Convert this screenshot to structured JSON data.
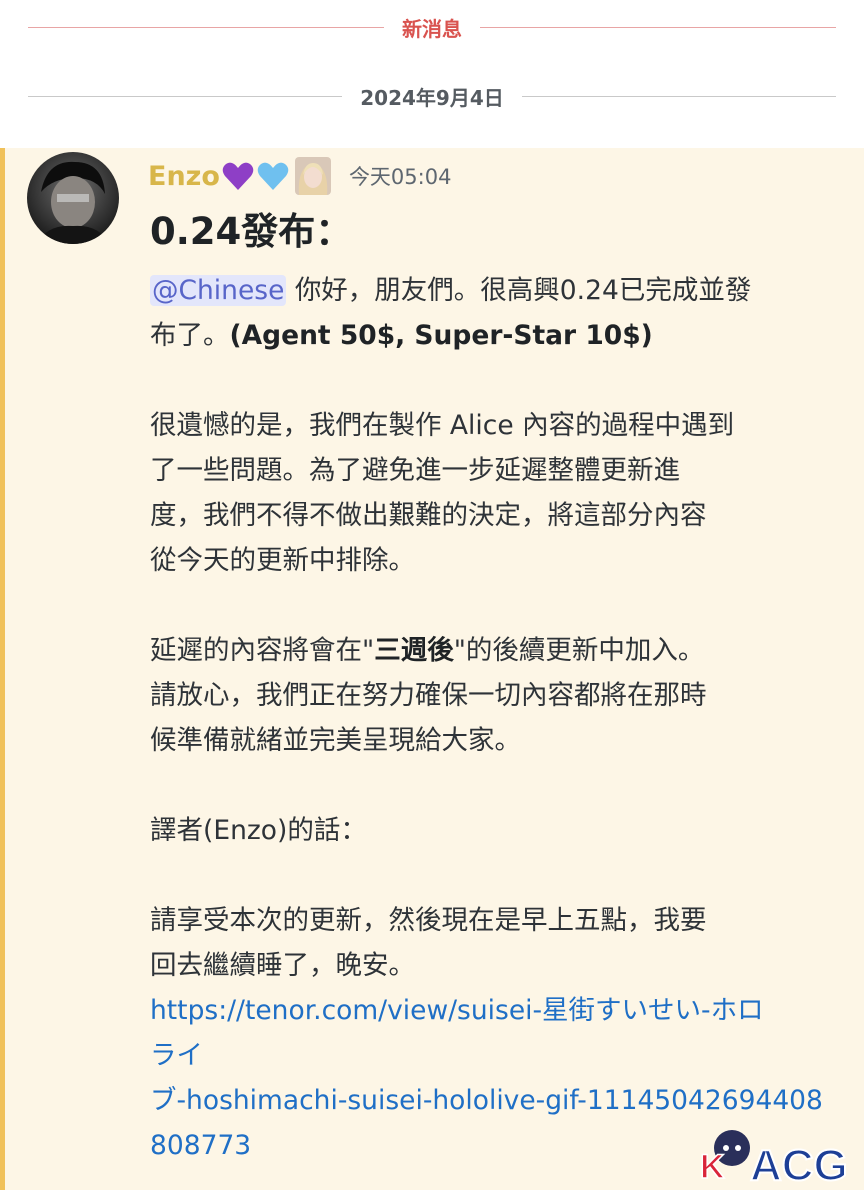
{
  "new_messages": "新消息",
  "date": "2024年9月4日",
  "message": {
    "username": "Enzo",
    "timestamp": "今天05:04",
    "title": "0.24發布：",
    "mention": "@Chinese",
    "greeting": "你好，朋友們。很高興0.24已完成並發布了。",
    "greeting_line1": "你好，朋友們。很高興0.24已完成並發",
    "greeting_line2": "布了。",
    "prices": "(Agent 50$, Super-Star 10$)",
    "para2_lines": [
      "很遺憾的是，我們在製作 Alice 內容的過程中遇到",
      "了一些問題。為了避免進一步延遲整體更新進",
      "度，我們不得不做出艱難的決定，將這部分內容",
      "從今天的更新中排除。"
    ],
    "para3_pre": "延遲的內容將會在\"",
    "para3_bold": "三週後",
    "para3_post": "\"的後續更新中加入。",
    "para3_lines": [
      "請放心，我們正在努力確保一切內容都將在那時",
      "候準備就緒並完美呈現給大家。"
    ],
    "translator_heading": "譯者(Enzo)的話：",
    "para5_lines": [
      "請享受本次的更新，然後現在是早上五點，我要",
      "回去繼續睡了，晚安。"
    ],
    "link": "https://tenor.com/view/suisei-星街すいせい-ホロライブ-hoshimachi-suisei-hololive-gif-11145042694408808773",
    "link_lines": [
      "https://tenor.com/view/suisei-星街すいせい-ホロ",
      "ライ",
      "ブ-hoshimachi-suisei-hololive-gif-11145042694408",
      "808773"
    ]
  },
  "watermark": "ACG",
  "colors": {
    "new_messages": "#d9534f",
    "username": "#d8b64a",
    "mention_bg": "#e3e6fb",
    "mention_text": "#5865c9",
    "link": "#1f6fc6",
    "message_bg": "#fdf6e6",
    "highlight_bar": "#f0c15a"
  },
  "icons": [
    "purple-heart-icon",
    "light-blue-heart-icon",
    "role-icon"
  ]
}
